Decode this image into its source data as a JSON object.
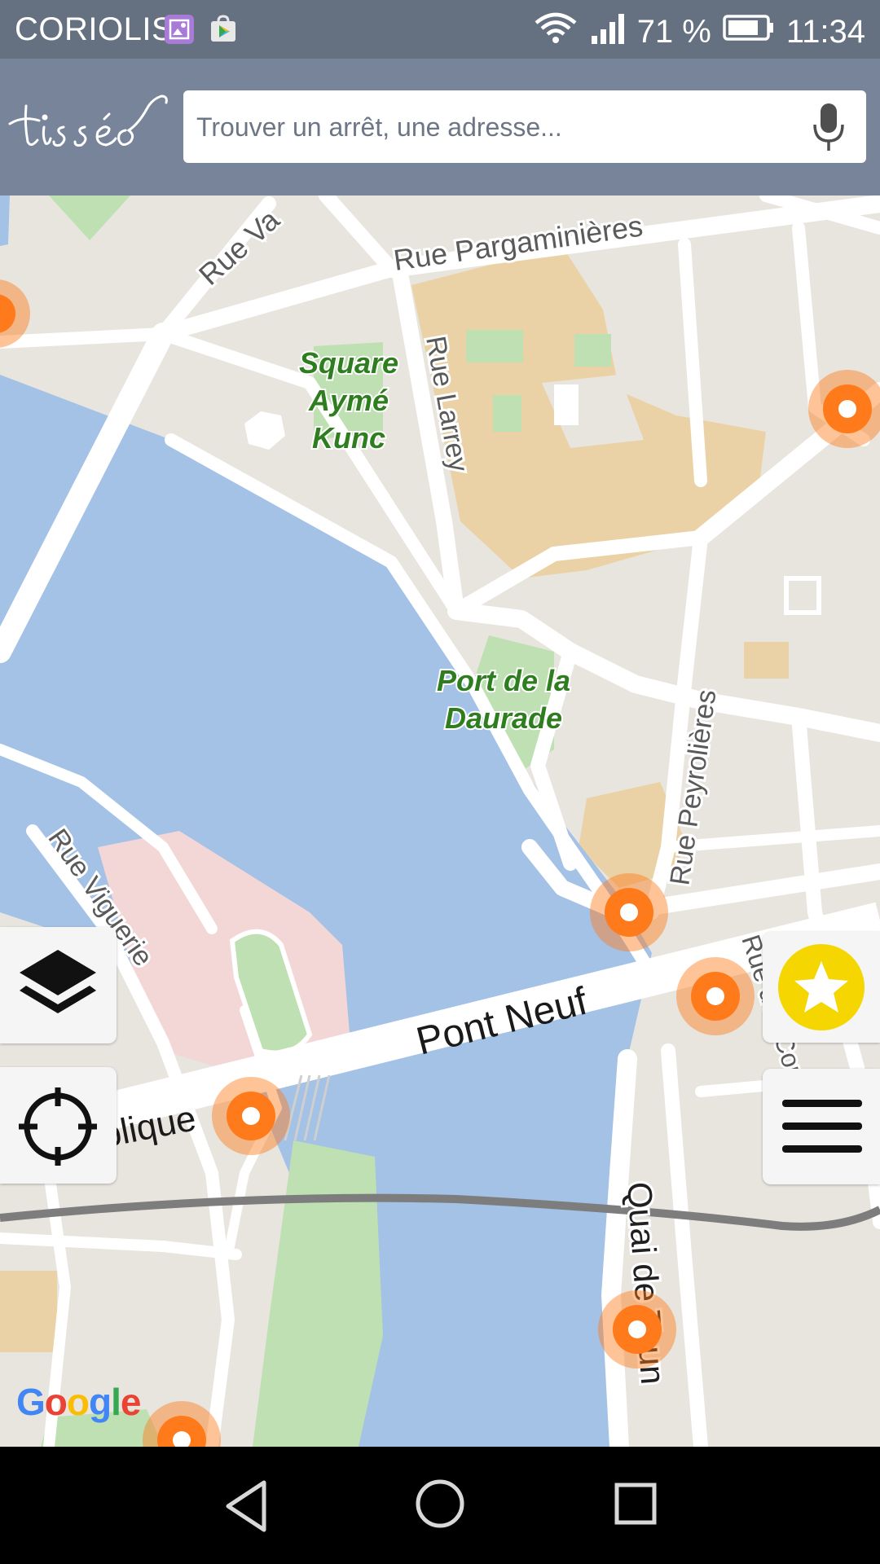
{
  "status_bar": {
    "carrier": "CORIOLIS",
    "battery": "71 %",
    "time": "11:34",
    "icons": [
      "gallery-notification-icon",
      "play-store-notification-icon",
      "wifi-icon",
      "signal-icon",
      "battery-icon"
    ]
  },
  "app_bar": {
    "logo_text": "tisséo",
    "search_placeholder": "Trouver un arrêt, une adresse...",
    "mic_icon": "mic-icon"
  },
  "map": {
    "street_labels": {
      "rue_va": "Rue Va",
      "rue_pargaminieres": "Rue Pargaminières",
      "rue_larrey": "Rue Larrey",
      "rue_peyrolieres": "Rue Peyrolières",
      "rue_viguerie": "Rue Viguerie",
      "pont_neuf": "Pont Neuf",
      "republique": "a République",
      "quai_de_tounis": "Quai de Toun",
      "rue_des_couteliers": "Rue des Couteliers"
    },
    "park_labels": {
      "square_line1": "Square",
      "square_line2": "Aymé",
      "square_line3": "Kunc",
      "port_line1": "Port de la",
      "port_line2": "Daurade"
    },
    "attribution": "Google",
    "colors": {
      "water": "#a4c1e6",
      "land": "#e8e5df",
      "road": "#ffffff",
      "building": "#ebd2a6",
      "park": "#bfe0b3",
      "hospital": "#f3d6d6",
      "stop": "#ff7a1a"
    }
  },
  "controls": {
    "layers_icon": "layers-icon",
    "locate_icon": "locate-crosshair-icon",
    "favorites_icon": "star-icon",
    "menu_icon": "hamburger-menu-icon"
  },
  "nav_bar": {
    "icons": [
      "back-icon",
      "home-icon",
      "recents-icon"
    ]
  }
}
